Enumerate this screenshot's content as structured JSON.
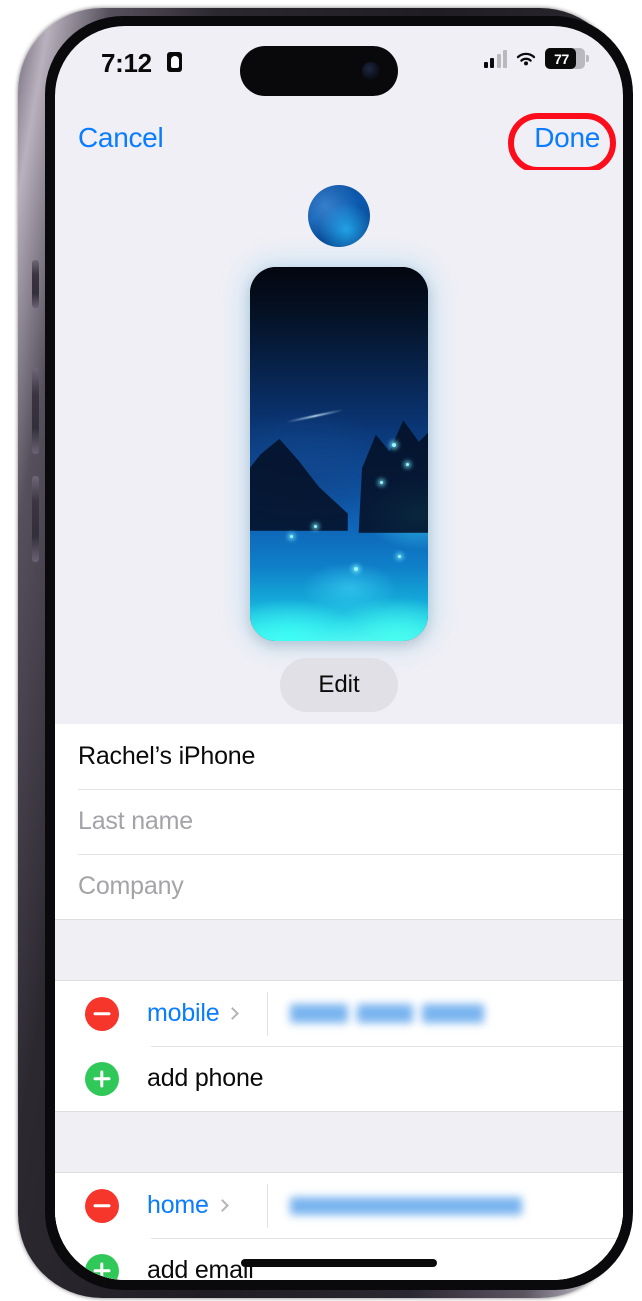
{
  "status_bar": {
    "time": "7:12",
    "focus_icon": "contact-badge-icon",
    "cellular_icon": "cellular-signal-icon",
    "wifi_icon": "wifi-icon",
    "battery_level": "77",
    "battery_icon": "battery-icon"
  },
  "nav_bar": {
    "cancel_label": "Cancel",
    "done_label": "Done",
    "highlight_color": "#fc0d1b"
  },
  "poster": {
    "avatar_icon": "contact-avatar",
    "preview_icon": "contact-poster-preview",
    "edit_label": "Edit"
  },
  "name_fields": [
    {
      "value": "Rachel’s iPhone",
      "placeholder": "First name",
      "filled": true
    },
    {
      "value": "Last name",
      "placeholder": "Last name",
      "filled": false
    },
    {
      "value": "Company",
      "placeholder": "Company",
      "filled": false
    }
  ],
  "phone_section": {
    "entry": {
      "remove_icon": "minus-circle-icon",
      "label": "mobile",
      "chevron_icon": "chevron-right-icon",
      "value": "",
      "value_redacted": true
    },
    "add_row": {
      "add_icon": "plus-circle-icon",
      "label": "add phone"
    }
  },
  "email_section": {
    "entry": {
      "remove_icon": "minus-circle-icon",
      "label": "home",
      "chevron_icon": "chevron-right-icon",
      "value": "",
      "value_redacted": true
    },
    "add_row": {
      "add_icon": "plus-circle-icon",
      "label": "add email"
    }
  },
  "colors": {
    "accent_blue": "#0a7cff",
    "destructive_red": "#f6352b",
    "additive_green": "#31c85a",
    "screen_background": "#f0eff5",
    "list_background": "#efeff4"
  }
}
